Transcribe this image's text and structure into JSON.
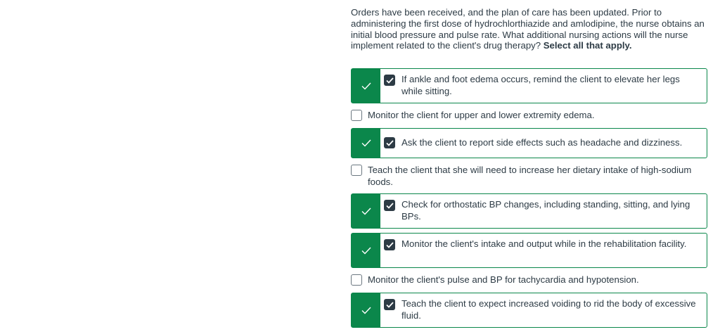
{
  "question": {
    "text": "Orders have been received, and the plan of care has been updated. Prior to administering the first dose of hydrochlorthiazide and amlodipine, the nurse obtains an initial blood pressure and pulse rate. What additional nursing actions will the nurse implement related to the client's drug therapy? ",
    "instruction": "Select all that apply."
  },
  "options": [
    {
      "label": "If ankle and foot edema occurs, remind the client to elevate her legs while sitting.",
      "checked": true,
      "status": "correct"
    },
    {
      "label": "Monitor the client for upper and lower extremity edema.",
      "checked": false,
      "status": "none"
    },
    {
      "label": "Ask the client to report side effects such as headache and dizziness.",
      "checked": true,
      "status": "correct"
    },
    {
      "label": "Teach the client that she will need to increase her dietary intake of high-sodium foods.",
      "checked": false,
      "status": "none"
    },
    {
      "label": "Check for orthostatic BP changes, including standing, sitting, and lying BPs.",
      "checked": true,
      "status": "correct"
    },
    {
      "label": "Monitor the client's intake and output while in the rehabilitation facility.",
      "checked": true,
      "status": "correct"
    },
    {
      "label": "Monitor the client's pulse and BP for tachycardia and hypotension.",
      "checked": false,
      "status": "none"
    },
    {
      "label": "Teach the client to expect increased voiding to rid the body of excessive fluid.",
      "checked": true,
      "status": "correct"
    }
  ],
  "colors": {
    "correct": "#0b874b",
    "checkbox_fill": "#2d3b45",
    "text": "#2d3b45"
  },
  "icons": {
    "correct_marker": "checkmark-icon",
    "checkbox_checked": "checkbox-checked-icon",
    "checkbox_empty": "checkbox-empty-icon"
  }
}
